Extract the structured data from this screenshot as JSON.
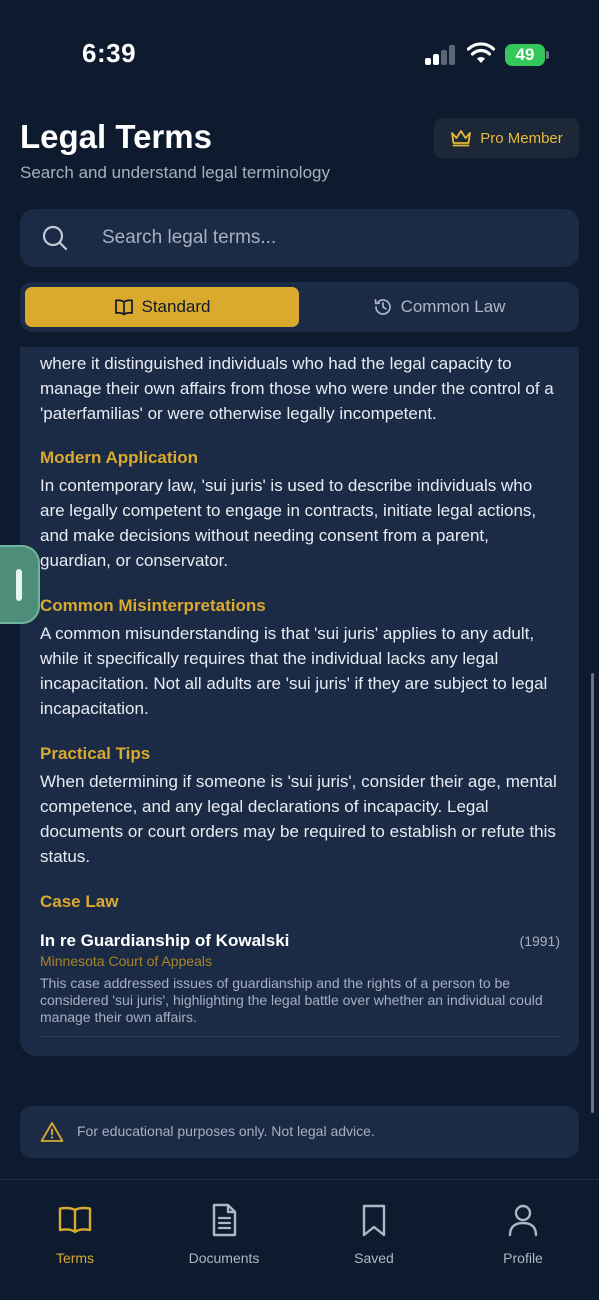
{
  "status_bar": {
    "time": "6:39",
    "battery": "49"
  },
  "header": {
    "title": "Legal Terms",
    "subtitle": "Search and understand legal terminology",
    "badge_label": "Pro Member"
  },
  "search": {
    "placeholder": "Search legal terms...",
    "value": ""
  },
  "segmented": {
    "options": [
      {
        "label": "Standard",
        "icon": "book-icon",
        "selected": true
      },
      {
        "label": "Common Law",
        "icon": "history-icon",
        "selected": false
      }
    ]
  },
  "content": {
    "intro_fragment": "where it distinguished individuals who had the legal capacity to manage their own affairs from those who were under the control of a 'paterfamilias' or were otherwise legally incompetent.",
    "sections": [
      {
        "title": "Modern Application",
        "body": "In contemporary law, 'sui juris' is used to describe individuals who are legally competent to engage in contracts, initiate legal actions, and make decisions without needing consent from a parent, guardian, or conservator."
      },
      {
        "title": "Common Misinterpretations",
        "body": "A common misunderstanding is that 'sui juris' applies to any adult, while it specifically requires that the individual lacks any legal incapacitation. Not all adults are 'sui juris' if they are subject to legal incapacitation."
      },
      {
        "title": "Practical Tips",
        "body": "When determining if someone is 'sui juris', consider their age, mental competence, and any legal declarations of incapacity. Legal documents or court orders may be required to establish or refute this status."
      }
    ],
    "case_law": {
      "title": "Case Law",
      "cases": [
        {
          "name": "In re Guardianship of Kowalski",
          "year": "(1991)",
          "court": "Minnesota Court of Appeals",
          "description": "This case addressed issues of guardianship and the rights of a person to be considered 'sui juris', highlighting the legal battle over whether an individual could manage their own affairs."
        }
      ]
    }
  },
  "disclaimer": {
    "icon": "warning-icon",
    "text": "For educational purposes only. Not legal advice."
  },
  "tab_bar": {
    "tabs": [
      {
        "label": "Terms",
        "icon": "book-open-icon",
        "active": true
      },
      {
        "label": "Documents",
        "icon": "document-icon",
        "active": false
      },
      {
        "label": "Saved",
        "icon": "bookmark-icon",
        "active": false
      },
      {
        "label": "Profile",
        "icon": "user-icon",
        "active": false
      }
    ]
  },
  "colors": {
    "background": "#0e1a2e",
    "card": "#1b2a45",
    "accent_gold": "#d9aa2e",
    "text_primary": "#e8ecf3",
    "text_secondary": "#a7b0c0"
  }
}
